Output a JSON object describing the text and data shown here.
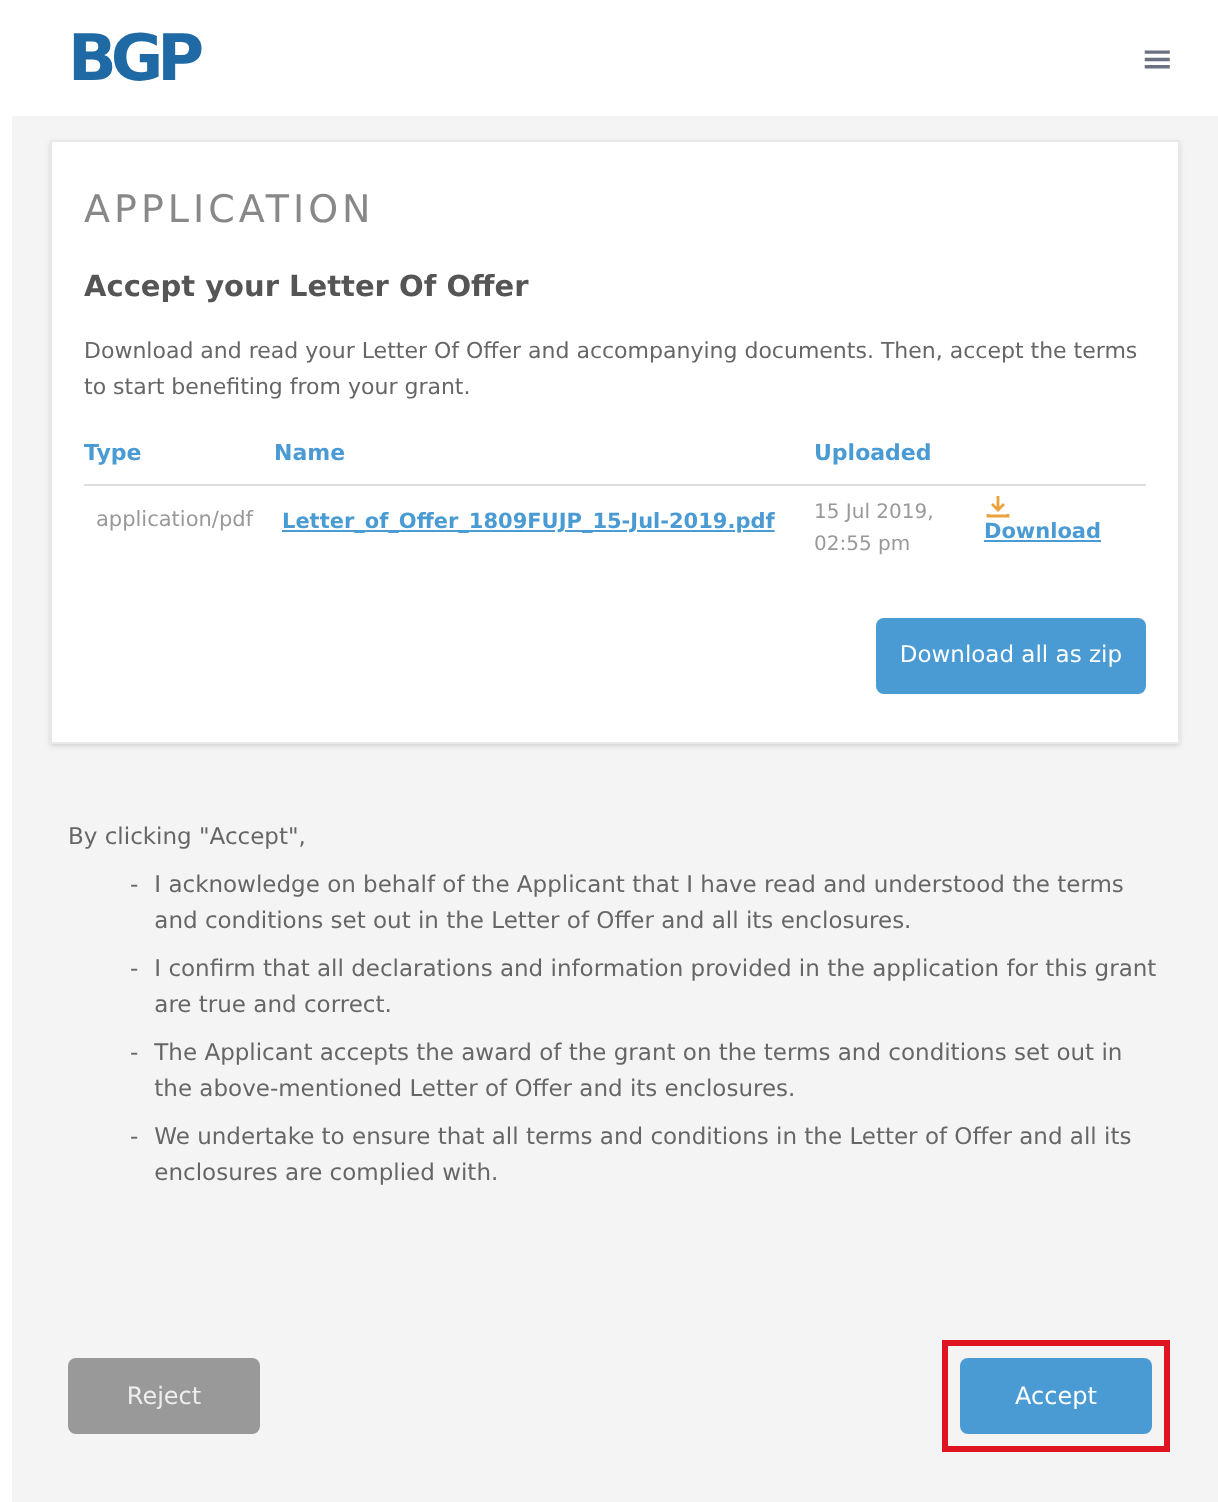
{
  "header": {
    "logo": "BGP",
    "menu_icon": "≡"
  },
  "card": {
    "section_title": "APPLICATION",
    "heading": "Accept your Letter Of Offer",
    "description": "Download and read your Letter Of Offer and accompanying documents. Then, accept the terms to start benefiting from your grant.",
    "table": {
      "columns": [
        "Type",
        "Name",
        "Uploaded"
      ],
      "rows": [
        {
          "type": "application/pdf",
          "name": "Letter_of_Offer_1809FUJP_15-Jul-2019.pdf",
          "uploaded": [
            "15 Jul 2019,",
            "02:55 pm"
          ],
          "action": "Download"
        }
      ]
    },
    "zip_button": "Download all as zip"
  },
  "terms": {
    "intro": "By clicking \"Accept\",",
    "items": [
      {
        "marker": "-",
        "text": "I acknowledge on behalf of the Applicant that I have read and understood the terms and conditions set out in the Letter of Offer and all its enclosures."
      },
      {
        "marker": "-",
        "text": "I confirm that all declarations and information provided in the application for this grant are true and correct."
      },
      {
        "marker": "-",
        "text": "The Applicant accepts the award of the grant on the terms and conditions set out in the above-mentioned Letter of Offer and its enclosures."
      },
      {
        "marker": "-",
        "text": "We undertake to ensure that all terms and conditions in the Letter of Offer and all its enclosures are complied with."
      }
    ]
  },
  "actions": [
    {
      "kind": "reject",
      "label": "Reject",
      "highlighted": false
    },
    {
      "kind": "accept",
      "label": "Accept",
      "highlighted": true
    }
  ]
}
